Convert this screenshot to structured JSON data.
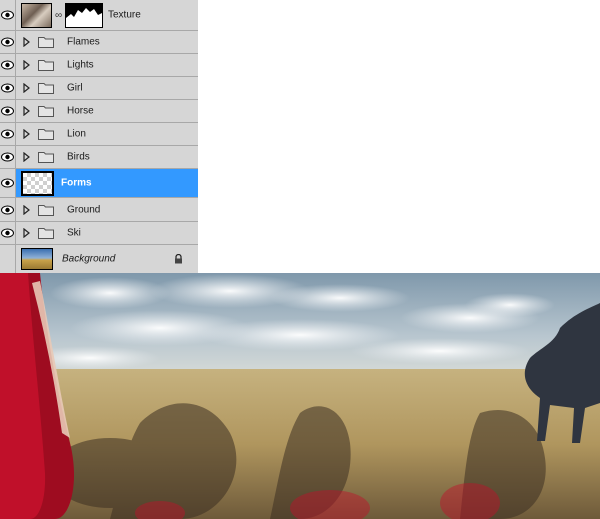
{
  "layers_panel": {
    "layers": [
      {
        "name": "Texture",
        "type": "layer-with-mask",
        "visible": true,
        "selected": false
      },
      {
        "name": "Flames",
        "type": "group",
        "visible": true,
        "selected": false
      },
      {
        "name": "Lights",
        "type": "group",
        "visible": true,
        "selected": false
      },
      {
        "name": "Girl",
        "type": "group",
        "visible": true,
        "selected": false
      },
      {
        "name": "Horse",
        "type": "group",
        "visible": true,
        "selected": false
      },
      {
        "name": "Lion",
        "type": "group",
        "visible": true,
        "selected": false
      },
      {
        "name": "Birds",
        "type": "group",
        "visible": true,
        "selected": false
      },
      {
        "name": "Forms",
        "type": "layer",
        "visible": true,
        "selected": true
      },
      {
        "name": "Ground",
        "type": "group",
        "visible": true,
        "selected": false
      },
      {
        "name": "Ski",
        "type": "group",
        "visible": true,
        "selected": false
      },
      {
        "name": "Background",
        "type": "background",
        "visible": false,
        "selected": false,
        "locked": true
      }
    ],
    "icons": {
      "visibility": "eye-icon",
      "expand": "triangle-right-icon",
      "group": "folder-icon",
      "link": "chain-link-icon",
      "lock": "lock-icon"
    },
    "colors": {
      "panel_bg": "#d6d6d6",
      "row_border": "#a8a8a8",
      "selected": "#3399ff"
    }
  },
  "canvas": {
    "content": "photo-composite",
    "colors": {
      "sky": "#8fa6b8",
      "field": "#b59a63",
      "red_dress": "#c0102a",
      "horse": "#2f3540"
    }
  }
}
